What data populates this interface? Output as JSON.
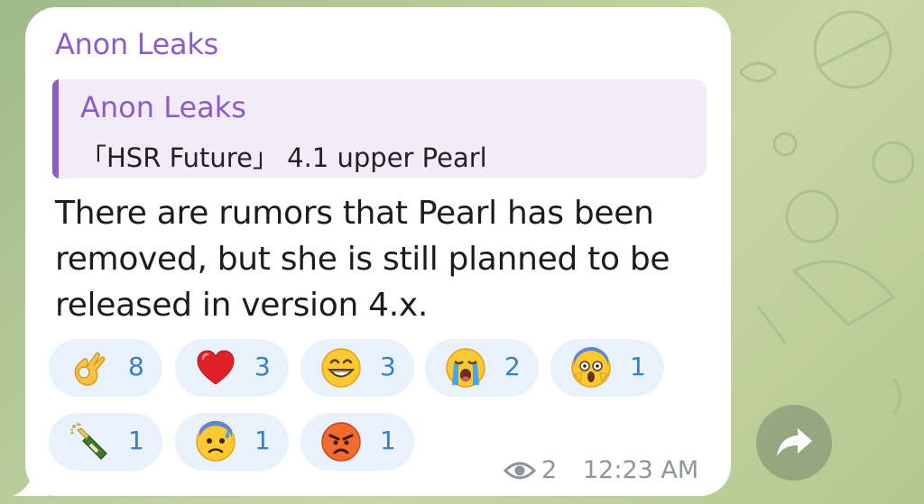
{
  "message": {
    "sender": "Anon Leaks",
    "reply": {
      "author": "Anon Leaks",
      "text": "「HSR Future」 4.1 upper Pearl"
    },
    "body_lines": [
      "There are rumors that Pearl has been",
      "removed, but she is still planned to be",
      "released in version 4.x."
    ],
    "reactions": [
      {
        "icon": "ok-hand-emoji",
        "count": "8"
      },
      {
        "icon": "red-heart-emoji",
        "count": "3"
      },
      {
        "icon": "grinning-face-emoji",
        "count": "3"
      },
      {
        "icon": "loudly-crying-face-emoji",
        "count": "2"
      },
      {
        "icon": "screaming-face-emoji",
        "count": "1"
      },
      {
        "icon": "champagne-bottle-emoji",
        "count": "1"
      },
      {
        "icon": "anxious-face-with-sweat-emoji",
        "count": "1"
      },
      {
        "icon": "angry-face-emoji",
        "count": "1"
      }
    ],
    "views": "2",
    "time": "12:23 AM"
  },
  "colors": {
    "accent": "#8c5cc7",
    "reaction_bg": "#e9f1fb",
    "reaction_count": "#3a7fc4",
    "meta_text": "#8e9499"
  }
}
